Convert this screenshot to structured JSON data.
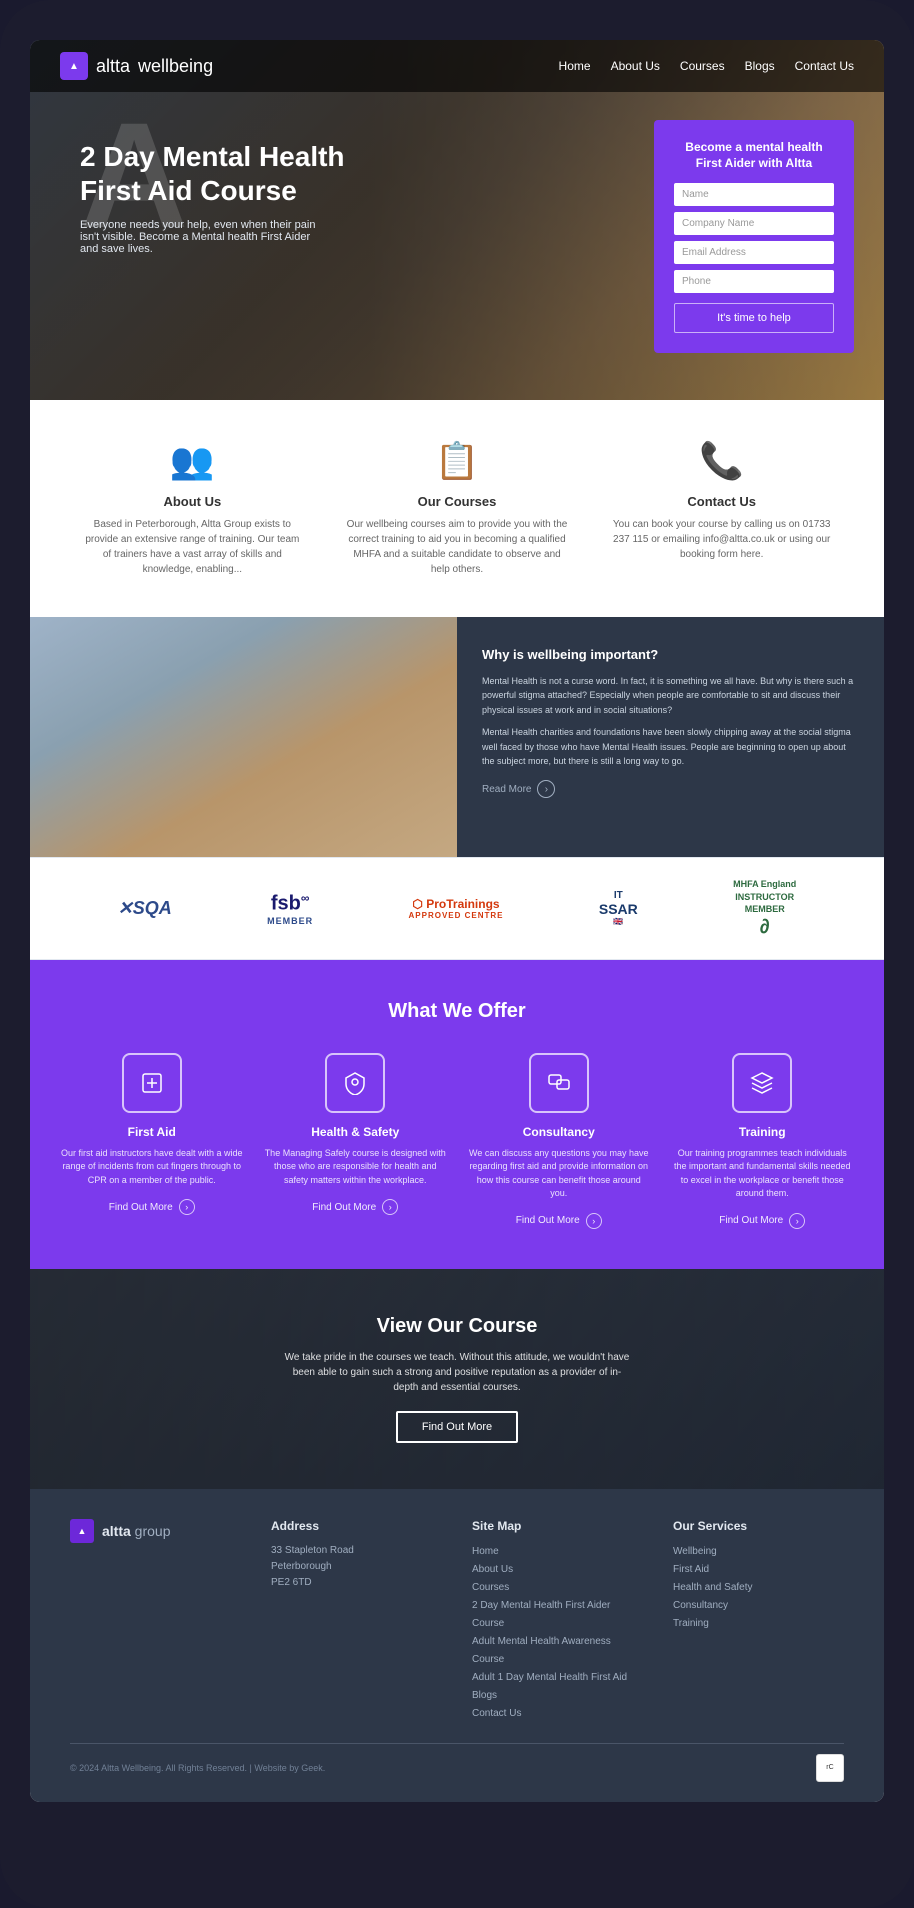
{
  "nav": {
    "logo_icon": "▲",
    "logo_brand": "altta",
    "logo_sub": " wellbeing",
    "links": [
      "Home",
      "About Us",
      "Courses",
      "Blogs",
      "Contact Us"
    ]
  },
  "hero": {
    "big_letter": "A",
    "title": "2 Day Mental Health\nFirst Aid Course",
    "subtitle": "Everyone needs your help, even when their pain isn't visible. Become a Mental health First Aider and save lives.",
    "form": {
      "heading_line1": "Become a mental health",
      "heading_line2": "First Aider with Altta",
      "name_placeholder": "Name",
      "company_placeholder": "Company Name",
      "email_placeholder": "Email Address",
      "phone_placeholder": "Phone",
      "btn_label": "It's time to help"
    }
  },
  "features": [
    {
      "icon": "👥",
      "title": "About Us",
      "desc": "Based in Peterborough, Altta Group exists to provide an extensive range of training. Our team of trainers have a vast array of skills and knowledge, enabling..."
    },
    {
      "icon": "📋",
      "title": "Our Courses",
      "desc": "Our wellbeing courses aim to provide you with the correct training to aid you in becoming a qualified MHFA and a suitable candidate to observe and help others."
    },
    {
      "icon": "📞",
      "title": "Contact Us",
      "desc": "You can book your course by calling us on 01733 237 115 or emailing info@altta.co.uk or using our booking form here."
    }
  ],
  "wellbeing": {
    "question": "Why is wellbeing important?",
    "para1": "Mental Health is not a curse word. In fact, it is something we all have. But why is there such a powerful stigma attached? Especially when people are comfortable to sit and discuss their physical issues at work and in social situations?",
    "para2": "Mental Health charities and foundations have been slowly chipping away at the social stigma well faced by those who have Mental Health issues. People are beginning to open up about the subject more, but there is still a long way to go.",
    "read_more": "Read More"
  },
  "partners": [
    {
      "name": "SQA",
      "display": "✕SQA"
    },
    {
      "name": "FSB Member",
      "top": "fsb",
      "sup": "∞",
      "bottom": "MEMBER"
    },
    {
      "name": "ProTrainings Approved Centre",
      "top": "ProTrainings",
      "bottom": "APPROVED CENTRE"
    },
    {
      "name": "ITSSAR",
      "display": "ITSSAR"
    },
    {
      "name": "MHFA England Instructor Member",
      "display": "MHFA England\nINSTRUCTOR\nMEMBER"
    }
  ],
  "offer": {
    "title": "What We Offer",
    "items": [
      {
        "icon": "✚",
        "title": "First Aid",
        "desc": "Our first aid instructors have dealt with a wide range of incidents from cut fingers through to CPR on a member of the public.",
        "link": "Find Out More"
      },
      {
        "icon": "⛑",
        "title": "Health & Safety",
        "desc": "The Managing Safely course is designed with those who are responsible for health and safety matters within the workplace.",
        "link": "Find Out More"
      },
      {
        "icon": "💬",
        "title": "Consultancy",
        "desc": "We can discuss any questions you may have regarding first aid and provide information on how this course can benefit those around you.",
        "link": "Find Out More"
      },
      {
        "icon": "🎓",
        "title": "Training",
        "desc": "Our training programmes teach individuals the important and fundamental skills needed to excel in the workplace or benefit those around them.",
        "link": "Find Out More"
      }
    ]
  },
  "view_course": {
    "title": "View Our Course",
    "text": "We take pride in the courses we teach. Without this attitude, we wouldn't have been able to gain such a strong and positive reputation as a provider of in-depth and essential courses.",
    "btn": "Find Out More"
  },
  "footer": {
    "logo_icon": "▲",
    "logo_brand": "altta",
    "logo_sub": " group",
    "address": {
      "title": "Address",
      "line1": "33 Stapleton Road",
      "line2": "Peterborough",
      "line3": "PE2 6TD"
    },
    "sitemap": {
      "title": "Site Map",
      "links": [
        "Home",
        "About Us",
        "Courses",
        "2 Day Mental Health First Aider Course",
        "Adult Mental Health Awareness Course",
        "Adult 1 Day Mental Health First Aid",
        "Blogs",
        "Contact Us"
      ]
    },
    "services": {
      "title": "Our Services",
      "links": [
        "Wellbeing",
        "First Aid",
        "Health and Safety",
        "Consultancy",
        "Training"
      ]
    },
    "copyright": "© 2024 Altta Wellbeing. All Rights Reserved. | Website by Geek."
  }
}
